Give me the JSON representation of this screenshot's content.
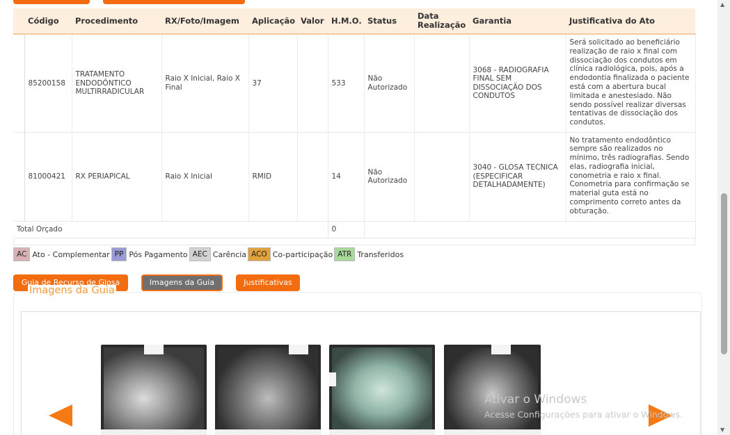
{
  "table": {
    "headers": [
      "Código",
      "Procedimento",
      "RX/Foto/Imagem",
      "Aplicação",
      "Valor",
      "H.M.O.",
      "Status",
      "Data Realização",
      "Garantia",
      "Justificativa do Ato"
    ],
    "rows": [
      {
        "codigo": "85200158",
        "procedimento": "TRATAMENTO ENDODÔNTICO MULTIRRADICULAR",
        "rx": "Raio X Inicial, Raio X Final",
        "aplicacao": "37",
        "valor": "",
        "hmo": "533",
        "status": "Não Autorizado",
        "data": "",
        "garantia": "3068 - RADIOGRAFIA FINAL SEM DISSOCIAÇÃO DOS CONDUTOS",
        "justificativa": "Será solicitado ao beneficiário realização de raio x final com dissociação dos condutos em clínica radiológica, pois, após a endodontia finalizada o paciente está com a abertura bucal limitada e anestesiado. Não sendo possível realizar diversas tentativas de dissociação dos condutos."
      },
      {
        "codigo": "81000421",
        "procedimento": "RX PERIAPICAL",
        "rx": "Raio X Inicial",
        "aplicacao": "RMID",
        "valor": "",
        "hmo": "14",
        "status": "Não Autorizado",
        "data": "",
        "garantia": "3040 - GLOSA TECNICA (ESPECIFICAR DETALHADAMENTE)",
        "justificativa": "No tratamento endodôntico sempre são realizados no mínimo, três radiografias. Sendo elas, radiografia inicial, conometria e raio x final. Conometria para confirmação se material guta está no comprimento correto antes da obturação."
      }
    ],
    "total_label": "Total Orçado",
    "total_hmo": "0"
  },
  "legend": [
    {
      "code": "AC",
      "label": "Ato - Complementar",
      "color": "#d9b3b3"
    },
    {
      "code": "PP",
      "label": "Pós Pagamento",
      "color": "#9a9ad6"
    },
    {
      "code": "AEC",
      "label": "Carência",
      "color": "#d3d3d3"
    },
    {
      "code": "ACO",
      "label": "Co-participação",
      "color": "#e0a23c"
    },
    {
      "code": "ATR",
      "label": "Transferidos",
      "color": "#a8d89a"
    }
  ],
  "buttons": {
    "recurso": "Guia de Recurso de Glosa",
    "imagens": "Imagens da Guia",
    "justificativas": "Justificativas"
  },
  "panel": {
    "title": "Imagens da Guia"
  },
  "watermark": {
    "line1": "Ativar o Windows",
    "line2": "Acesse Configurações para ativar o Windows."
  },
  "colors": {
    "accent": "#f36c10",
    "header_bg": "#fdeedd"
  }
}
